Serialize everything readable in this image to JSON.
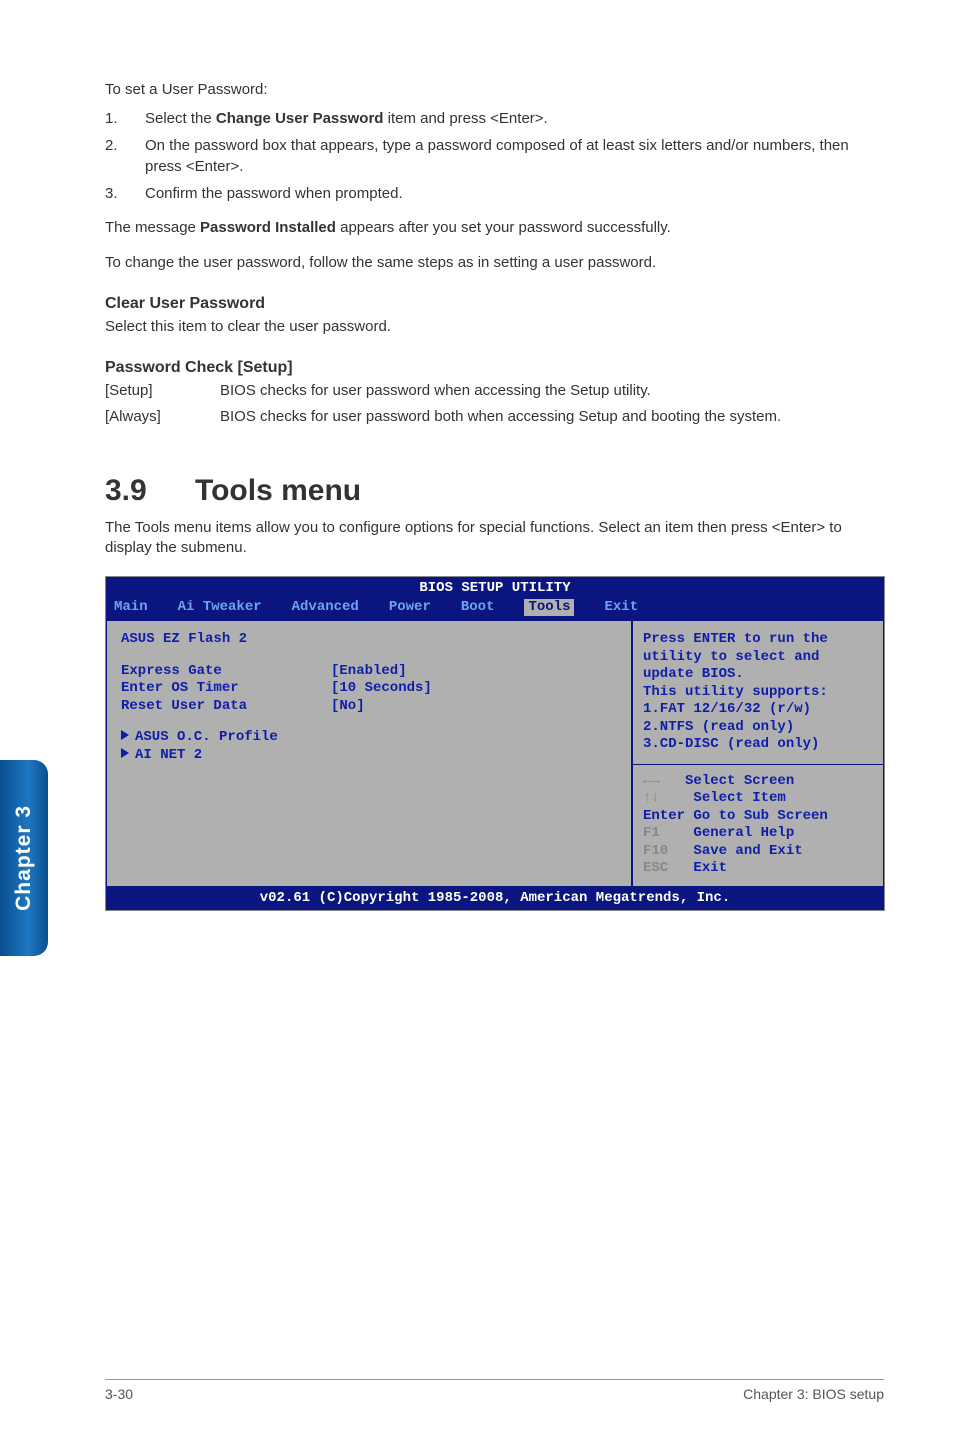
{
  "sideTab": "Chapter 3",
  "intro": {
    "p1": "To set a User Password:",
    "list": [
      {
        "num": "1.",
        "text_before": "Select the ",
        "bold": "Change User Password",
        "text_after": " item and press <Enter>."
      },
      {
        "num": "2.",
        "text_before": "On the password box that appears, type a password composed of at least six letters and/or numbers, then press <Enter>.",
        "bold": "",
        "text_after": ""
      },
      {
        "num": "3.",
        "text_before": "Confirm the password when prompted.",
        "bold": "",
        "text_after": ""
      }
    ],
    "msg_before": "The message ",
    "msg_bold": "Password Installed",
    "msg_after": " appears after you set your password successfully.",
    "p_change": "To change the user password, follow the same steps as in setting a user password."
  },
  "clear": {
    "heading": "Clear User Password",
    "text": "Select this item to clear the user password."
  },
  "check": {
    "heading": "Password Check [Setup]",
    "rows": [
      {
        "term": "[Setup]",
        "desc": "BIOS checks for user password when accessing the Setup utility."
      },
      {
        "term": "[Always]",
        "desc": "BIOS checks for user password both when accessing Setup and booting the system."
      }
    ]
  },
  "tools": {
    "num": "3.9",
    "title": "Tools menu",
    "desc": "The Tools menu items allow you to configure options for special functions. Select an item then press <Enter> to display the submenu."
  },
  "bios": {
    "title": "BIOS SETUP UTILITY",
    "tabs": [
      "Main",
      "Ai Tweaker",
      "Advanced",
      "Power",
      "Boot",
      "Tools",
      "Exit"
    ],
    "activeTab": "Tools",
    "main": {
      "line1": "ASUS EZ Flash 2",
      "items": [
        {
          "label": "Express Gate",
          "value": "[Enabled]",
          "indent": false
        },
        {
          "label": " Enter OS Timer",
          "value": "[10 Seconds]",
          "indent": false
        },
        {
          "label": " Reset User Data",
          "value": "[No]",
          "indent": false
        }
      ],
      "subs": [
        "ASUS O.C. Profile",
        "AI NET 2"
      ]
    },
    "help": {
      "l1": "Press ENTER to run the",
      "l2": "utility to select and",
      "l3": "update BIOS.",
      "l4": "This utility supports:",
      "l5": "1.FAT 12/16/32 (r/w)",
      "l6": "2.NTFS (read only)",
      "l7": "3.CD-DISC (read only)"
    },
    "keys": {
      "k1a": "←→",
      "k1b": "   Select Screen",
      "k2a": "↑↓",
      "k2b": "    Select Item",
      "k3": "Enter Go to Sub Screen",
      "k4a": "F1",
      "k4b": "    General Help",
      "k5a": "F10",
      "k5b": "   Save and Exit",
      "k6a": "ESC",
      "k6b": "   Exit"
    },
    "footer": "v02.61 (C)Copyright 1985-2008, American Megatrends, Inc."
  },
  "footer": {
    "left": "3-30",
    "right": "Chapter 3: BIOS setup"
  }
}
